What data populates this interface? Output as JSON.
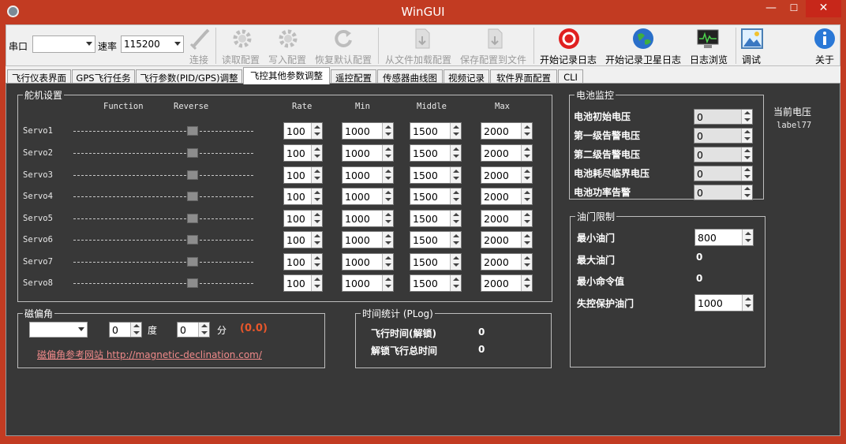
{
  "window": {
    "title": "WinGUI",
    "minimize": "—",
    "maximize": "☐",
    "close": "✕"
  },
  "toolbar": {
    "port_label": "串口",
    "port_value": "",
    "rate_label": "速率",
    "rate_value": "115200",
    "connect": "连接",
    "read_config": "读取配置",
    "write_config": "写入配置",
    "restore_default": "恢复默认配置",
    "load_from_file": "从文件加载配置",
    "save_to_file": "保存配置到文件",
    "start_log": "开始记录日志",
    "start_sat_log": "开始记录卫星日志",
    "browse_log": "日志浏览",
    "debug": "调试",
    "about": "关于"
  },
  "tabs": [
    "飞行仪表界面",
    "GPS飞行任务",
    "飞行参数(PID/GPS)调整",
    "飞控其他参数调整",
    "遥控配置",
    "传感器曲线图",
    "视频记录",
    "软件界面配置",
    "CLI"
  ],
  "servo": {
    "title": "舵机设置",
    "headers": {
      "function": "Function",
      "reverse": "Reverse",
      "rate": "Rate",
      "min": "Min",
      "middle": "Middle",
      "max": "Max"
    },
    "rows": [
      {
        "name": "Servo1",
        "rate": "100",
        "min": "1000",
        "middle": "1500",
        "max": "2000"
      },
      {
        "name": "Servo2",
        "rate": "100",
        "min": "1000",
        "middle": "1500",
        "max": "2000"
      },
      {
        "name": "Servo3",
        "rate": "100",
        "min": "1000",
        "middle": "1500",
        "max": "2000"
      },
      {
        "name": "Servo4",
        "rate": "100",
        "min": "1000",
        "middle": "1500",
        "max": "2000"
      },
      {
        "name": "Servo5",
        "rate": "100",
        "min": "1000",
        "middle": "1500",
        "max": "2000"
      },
      {
        "name": "Servo6",
        "rate": "100",
        "min": "1000",
        "middle": "1500",
        "max": "2000"
      },
      {
        "name": "Servo7",
        "rate": "100",
        "min": "1000",
        "middle": "1500",
        "max": "2000"
      },
      {
        "name": "Servo8",
        "rate": "100",
        "min": "1000",
        "middle": "1500",
        "max": "2000"
      }
    ]
  },
  "battery": {
    "title": "电池监控",
    "rows": [
      {
        "label": "电池初始电压",
        "value": "0"
      },
      {
        "label": "第一级告警电压",
        "value": "0"
      },
      {
        "label": "第二级告警电压",
        "value": "0"
      },
      {
        "label": "电池耗尽临界电压",
        "value": "0"
      },
      {
        "label": "电池功率告警",
        "value": "0"
      }
    ],
    "current_label": "当前电压",
    "current_value": "label77"
  },
  "throttle": {
    "title": "油门限制",
    "min_label": "最小油门",
    "min_value": "800",
    "max_label": "最大油门",
    "max_value": "0",
    "mincmd_label": "最小命令值",
    "mincmd_value": "0",
    "failsafe_label": "失控保护油门",
    "failsafe_value": "1000"
  },
  "declination": {
    "title": "磁偏角",
    "dir_value": "",
    "deg_value": "0",
    "deg_unit": "度",
    "min_value": "0",
    "min_unit": "分",
    "result": "(0.0)",
    "link": "磁偏角参考网站  http://magnetic-declination.com/"
  },
  "timestats": {
    "title": "时间统计 (PLog)",
    "fly_label": "飞行时间(解锁)",
    "fly_value": "0",
    "total_label": "解锁飞行总时间",
    "total_value": "0"
  },
  "colors": {
    "titlebar": "#c23b22",
    "panel": "#383838",
    "accent": "#e8572b"
  }
}
